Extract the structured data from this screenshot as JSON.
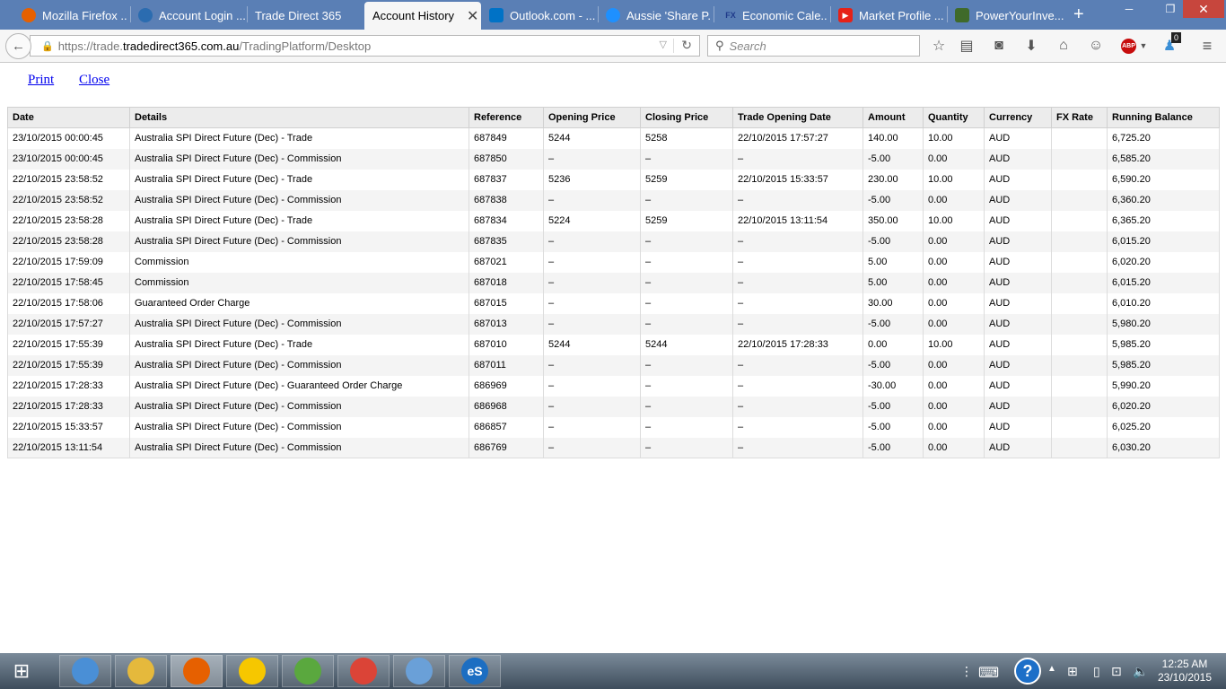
{
  "browser": {
    "tabs": [
      {
        "label": "Mozilla Firefox ...",
        "icon": "firefox-icon",
        "color": "#e66000"
      },
      {
        "label": "Account Login ...",
        "icon": "account-login-icon",
        "color": "#2b6cb0"
      },
      {
        "label": "Trade Direct 365",
        "icon": "",
        "color": ""
      },
      {
        "label": "Account History",
        "icon": "",
        "color": "",
        "active": true
      },
      {
        "label": "Outlook.com - ...",
        "icon": "outlook-icon",
        "color": "#0072c6"
      },
      {
        "label": "Aussie 'Share P...",
        "icon": "aussie-share-icon",
        "color": "#1e90ff"
      },
      {
        "label": "Economic Cale...",
        "icon": "fx-icon",
        "favicon_text": "FX",
        "color": "#1f3a8a"
      },
      {
        "label": "Market Profile ...",
        "icon": "youtube-icon",
        "color": "#e62117"
      },
      {
        "label": "PowerYourInve...",
        "icon": "poweryourinvest-icon",
        "color": "#3f6a2a"
      }
    ],
    "url": {
      "prefix": "https://trade.",
      "host": "tradedirect365.com.au",
      "path": "/TradingPlatform/Desktop"
    },
    "search_placeholder": "Search",
    "abp_label": "ABP",
    "badge_count": "0"
  },
  "page": {
    "links": {
      "print": "Print",
      "close": "Close"
    },
    "table": {
      "headers": [
        "Date",
        "Details",
        "Reference",
        "Opening Price",
        "Closing Price",
        "Trade Opening Date",
        "Amount",
        "Quantity",
        "Currency",
        "FX Rate",
        "Running Balance"
      ],
      "rows": [
        [
          "23/10/2015 00:00:45",
          "Australia SPI Direct Future (Dec) - Trade",
          "687849",
          "5244",
          "5258",
          "22/10/2015 17:57:27",
          "140.00",
          "10.00",
          "AUD",
          "",
          "6,725.20"
        ],
        [
          "23/10/2015 00:00:45",
          "Australia SPI Direct Future (Dec) - Commission",
          "687850",
          "–",
          "–",
          "–",
          "-5.00",
          "0.00",
          "AUD",
          "",
          "6,585.20"
        ],
        [
          "22/10/2015 23:58:52",
          "Australia SPI Direct Future (Dec) - Trade",
          "687837",
          "5236",
          "5259",
          "22/10/2015 15:33:57",
          "230.00",
          "10.00",
          "AUD",
          "",
          "6,590.20"
        ],
        [
          "22/10/2015 23:58:52",
          "Australia SPI Direct Future (Dec) - Commission",
          "687838",
          "–",
          "–",
          "–",
          "-5.00",
          "0.00",
          "AUD",
          "",
          "6,360.20"
        ],
        [
          "22/10/2015 23:58:28",
          "Australia SPI Direct Future (Dec) - Trade",
          "687834",
          "5224",
          "5259",
          "22/10/2015 13:11:54",
          "350.00",
          "10.00",
          "AUD",
          "",
          "6,365.20"
        ],
        [
          "22/10/2015 23:58:28",
          "Australia SPI Direct Future (Dec) - Commission",
          "687835",
          "–",
          "–",
          "–",
          "-5.00",
          "0.00",
          "AUD",
          "",
          "6,015.20"
        ],
        [
          "22/10/2015 17:59:09",
          "Commission",
          "687021",
          "–",
          "–",
          "–",
          "5.00",
          "0.00",
          "AUD",
          "",
          "6,020.20"
        ],
        [
          "22/10/2015 17:58:45",
          "Commission",
          "687018",
          "–",
          "–",
          "–",
          "5.00",
          "0.00",
          "AUD",
          "",
          "6,015.20"
        ],
        [
          "22/10/2015 17:58:06",
          "Guaranteed Order Charge",
          "687015",
          "–",
          "–",
          "–",
          "30.00",
          "0.00",
          "AUD",
          "",
          "6,010.20"
        ],
        [
          "22/10/2015 17:57:27",
          "Australia SPI Direct Future (Dec) - Commission",
          "687013",
          "–",
          "–",
          "–",
          "-5.00",
          "0.00",
          "AUD",
          "",
          "5,980.20"
        ],
        [
          "22/10/2015 17:55:39",
          "Australia SPI Direct Future (Dec) - Trade",
          "687010",
          "5244",
          "5244",
          "22/10/2015 17:28:33",
          "0.00",
          "10.00",
          "AUD",
          "",
          "5,985.20"
        ],
        [
          "22/10/2015 17:55:39",
          "Australia SPI Direct Future (Dec) - Commission",
          "687011",
          "–",
          "–",
          "–",
          "-5.00",
          "0.00",
          "AUD",
          "",
          "5,985.20"
        ],
        [
          "22/10/2015 17:28:33",
          "Australia SPI Direct Future (Dec) - Guaranteed Order Charge",
          "686969",
          "–",
          "–",
          "–",
          "-30.00",
          "0.00",
          "AUD",
          "",
          "5,990.20"
        ],
        [
          "22/10/2015 17:28:33",
          "Australia SPI Direct Future (Dec) - Commission",
          "686968",
          "–",
          "–",
          "–",
          "-5.00",
          "0.00",
          "AUD",
          "",
          "6,020.20"
        ],
        [
          "22/10/2015 15:33:57",
          "Australia SPI Direct Future (Dec) - Commission",
          "686857",
          "–",
          "–",
          "–",
          "-5.00",
          "0.00",
          "AUD",
          "",
          "6,025.20"
        ],
        [
          "22/10/2015 13:11:54",
          "Australia SPI Direct Future (Dec) - Commission",
          "686769",
          "–",
          "–",
          "–",
          "-5.00",
          "0.00",
          "AUD",
          "",
          "6,030.20"
        ]
      ]
    }
  },
  "taskbar": {
    "apps": [
      {
        "name": "control-panel-icon",
        "color": "#4a8fd6",
        "active": false
      },
      {
        "name": "file-explorer-icon",
        "color": "#e5b93c",
        "active": false
      },
      {
        "name": "firefox-icon",
        "color": "#e66000",
        "active": true
      },
      {
        "name": "norton-icon",
        "color": "#f6c700",
        "active": false
      },
      {
        "name": "evernote-icon",
        "color": "#5aa83e",
        "active": false
      },
      {
        "name": "chrome-icon",
        "color": "#db4437",
        "active": false
      },
      {
        "name": "remote-desktop-icon",
        "color": "#6aa0d8",
        "active": false
      },
      {
        "name": "esignal-icon",
        "color": "#1c6ec2",
        "label": "eS",
        "active": false
      }
    ],
    "clock": {
      "time": "12:25 AM",
      "date": "23/10/2015"
    }
  }
}
